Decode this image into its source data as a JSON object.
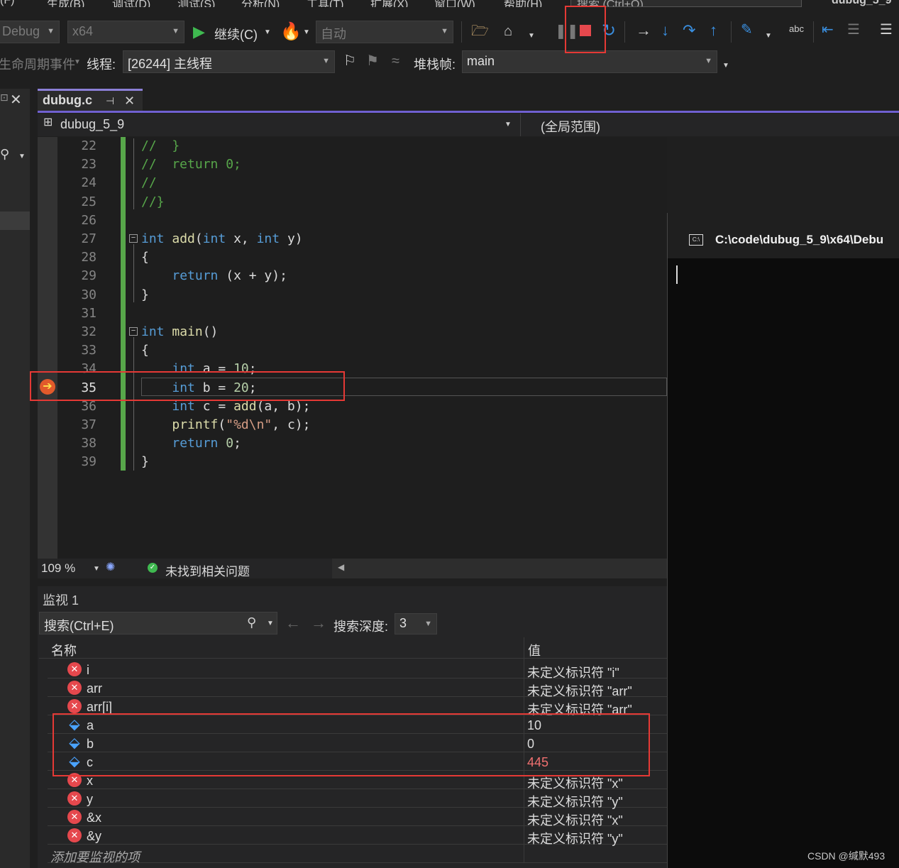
{
  "menu": [
    "(F)",
    "生成(B)",
    "调试(D)",
    "测试(S)",
    "分析(N)",
    "工具(T)",
    "扩展(X)",
    "窗口(W)",
    "帮助(H)"
  ],
  "search_placeholder": "搜索 (Ctrl+Q)",
  "window_title_partial": "dubug_5_9",
  "toolbar": {
    "config": "Debug",
    "platform": "x64",
    "continue_label": "继续(C)",
    "auto_label": "自动"
  },
  "debug_bar": {
    "lifecycle_label": "生命周期事件",
    "thread_label": "线程:",
    "thread_value": "[26244] 主线程",
    "stackframe_label": "堆栈帧:",
    "stackframe_value": "main"
  },
  "editor": {
    "tab_name": "dubug.c",
    "project_combo": "dubug_5_9",
    "scope_combo": "(全局范围)",
    "current_line": "35",
    "lines": [
      {
        "n": "22",
        "html": "<span class='cm'>//  }</span>"
      },
      {
        "n": "23",
        "html": "<span class='cm'>//  return 0;</span>"
      },
      {
        "n": "24",
        "html": "<span class='cm'>//</span>"
      },
      {
        "n": "25",
        "html": "<span class='cm'>//}</span>"
      },
      {
        "n": "26",
        "html": ""
      },
      {
        "n": "27",
        "html": "<span class='kw'>int</span> <span class='fn'>add</span>(<span class='kw'>int</span> x, <span class='kw'>int</span> y)"
      },
      {
        "n": "28",
        "html": "{"
      },
      {
        "n": "29",
        "html": "    <span class='kw'>return</span> (x + y);"
      },
      {
        "n": "30",
        "html": "}"
      },
      {
        "n": "31",
        "html": ""
      },
      {
        "n": "32",
        "html": "<span class='kw'>int</span> <span class='fn'>main</span>()"
      },
      {
        "n": "33",
        "html": "{"
      },
      {
        "n": "34",
        "html": "    <span class='kw'>int</span> a = <span class='num'>10</span>;"
      },
      {
        "n": "35",
        "html": "    <span class='kw'>int</span> b = <span class='num'>20</span>;"
      },
      {
        "n": "36",
        "html": "    <span class='kw'>int</span> c = <span class='fn'>add</span>(a, b);"
      },
      {
        "n": "37",
        "html": "    <span class='fn'>printf</span>(<span class='str'>\"%d\\n\"</span>, c);"
      },
      {
        "n": "38",
        "html": "    <span class='kw'>return</span> <span class='num'>0</span>;"
      },
      {
        "n": "39",
        "html": "}"
      }
    ]
  },
  "status": {
    "zoom": "109 %",
    "issues": "未找到相关问题"
  },
  "console": {
    "title": "C:\\code\\dubug_5_9\\x64\\Debu"
  },
  "watch": {
    "title": "监视 1",
    "search_placeholder": "搜索(Ctrl+E)",
    "depth_label": "搜索深度:",
    "depth_value": "3",
    "col_name": "名称",
    "col_value": "值",
    "rows": [
      {
        "name": "i",
        "value": "未定义标识符 \"i\"",
        "kind": "error"
      },
      {
        "name": "arr",
        "value": "未定义标识符 \"arr\"",
        "kind": "error"
      },
      {
        "name": "arr[i]",
        "value": "未定义标识符 \"arr\"",
        "kind": "error"
      },
      {
        "name": "a",
        "value": "10",
        "kind": "var"
      },
      {
        "name": "b",
        "value": "0",
        "kind": "var"
      },
      {
        "name": "c",
        "value": "445",
        "kind": "var-changed"
      },
      {
        "name": "x",
        "value": "未定义标识符 \"x\"",
        "kind": "error"
      },
      {
        "name": "y",
        "value": "未定义标识符 \"y\"",
        "kind": "error"
      },
      {
        "name": "&x",
        "value": "未定义标识符 \"x\"",
        "kind": "error"
      },
      {
        "name": "&y",
        "value": "未定义标识符 \"y\"",
        "kind": "error"
      }
    ],
    "add_item": "添加要监视的项"
  },
  "watermark": "CSDN @缄默493",
  "colors": {
    "accent": "#7060d0",
    "highlight_red": "#e53935",
    "changed_value": "#f07070"
  }
}
